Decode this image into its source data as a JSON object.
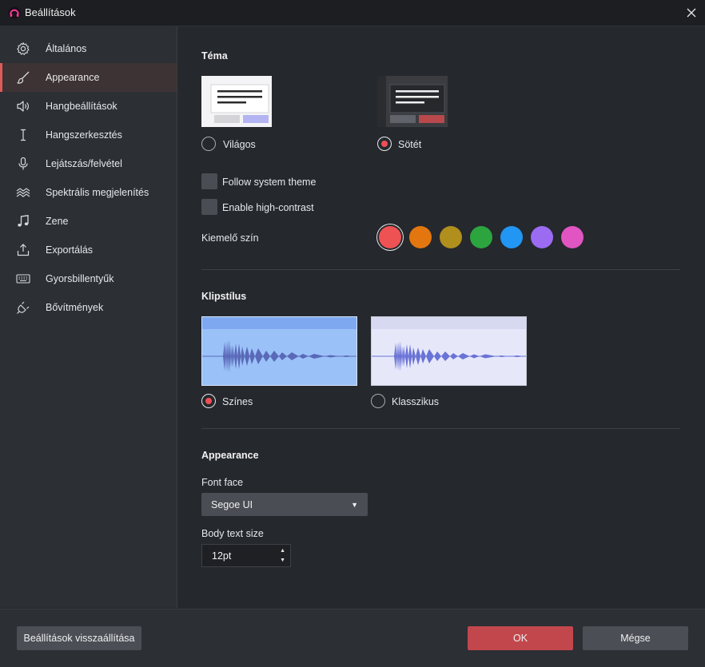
{
  "window": {
    "title": "Beállítások"
  },
  "sidebar": {
    "items": [
      {
        "label": "Általános",
        "icon": "gear-icon"
      },
      {
        "label": "Appearance",
        "icon": "brush-icon",
        "active": true
      },
      {
        "label": "Hangbeállítások",
        "icon": "speaker-icon"
      },
      {
        "label": "Hangszerkesztés",
        "icon": "text-cursor-icon"
      },
      {
        "label": "Lejátszás/felvétel",
        "icon": "microphone-icon"
      },
      {
        "label": "Spektrális megjelenítés",
        "icon": "waves-icon"
      },
      {
        "label": "Zene",
        "icon": "music-note-icon"
      },
      {
        "label": "Exportálás",
        "icon": "export-icon"
      },
      {
        "label": "Gyorsbillentyűk",
        "icon": "keyboard-icon"
      },
      {
        "label": "Bővítmények",
        "icon": "plug-icon"
      }
    ]
  },
  "theme": {
    "title": "Téma",
    "light_label": "Világos",
    "dark_label": "Sötét",
    "selected": "dark",
    "follow_system_label": "Follow system theme",
    "high_contrast_label": "Enable high-contrast",
    "accent_label": "Kiemelő szín",
    "accent_colors": [
      "#ee5253",
      "#e3760f",
      "#b08f1d",
      "#2ca53f",
      "#2196f3",
      "#9b6bf2",
      "#e055c2"
    ],
    "accent_selected": 0
  },
  "clip_style": {
    "title": "Klipstílus",
    "colorful_label": "Színes",
    "classic_label": "Klasszikus",
    "selected": "colorful"
  },
  "appearance": {
    "title": "Appearance",
    "font_face_label": "Font face",
    "font_face_value": "Segoe UI",
    "body_text_size_label": "Body text size",
    "body_text_size_value": "12pt"
  },
  "footer": {
    "reset_label": "Beállítások visszaállítása",
    "ok_label": "OK",
    "cancel_label": "Mégse"
  },
  "colors": {
    "accent": "#e05a5a",
    "ok_button": "#c2474d"
  }
}
